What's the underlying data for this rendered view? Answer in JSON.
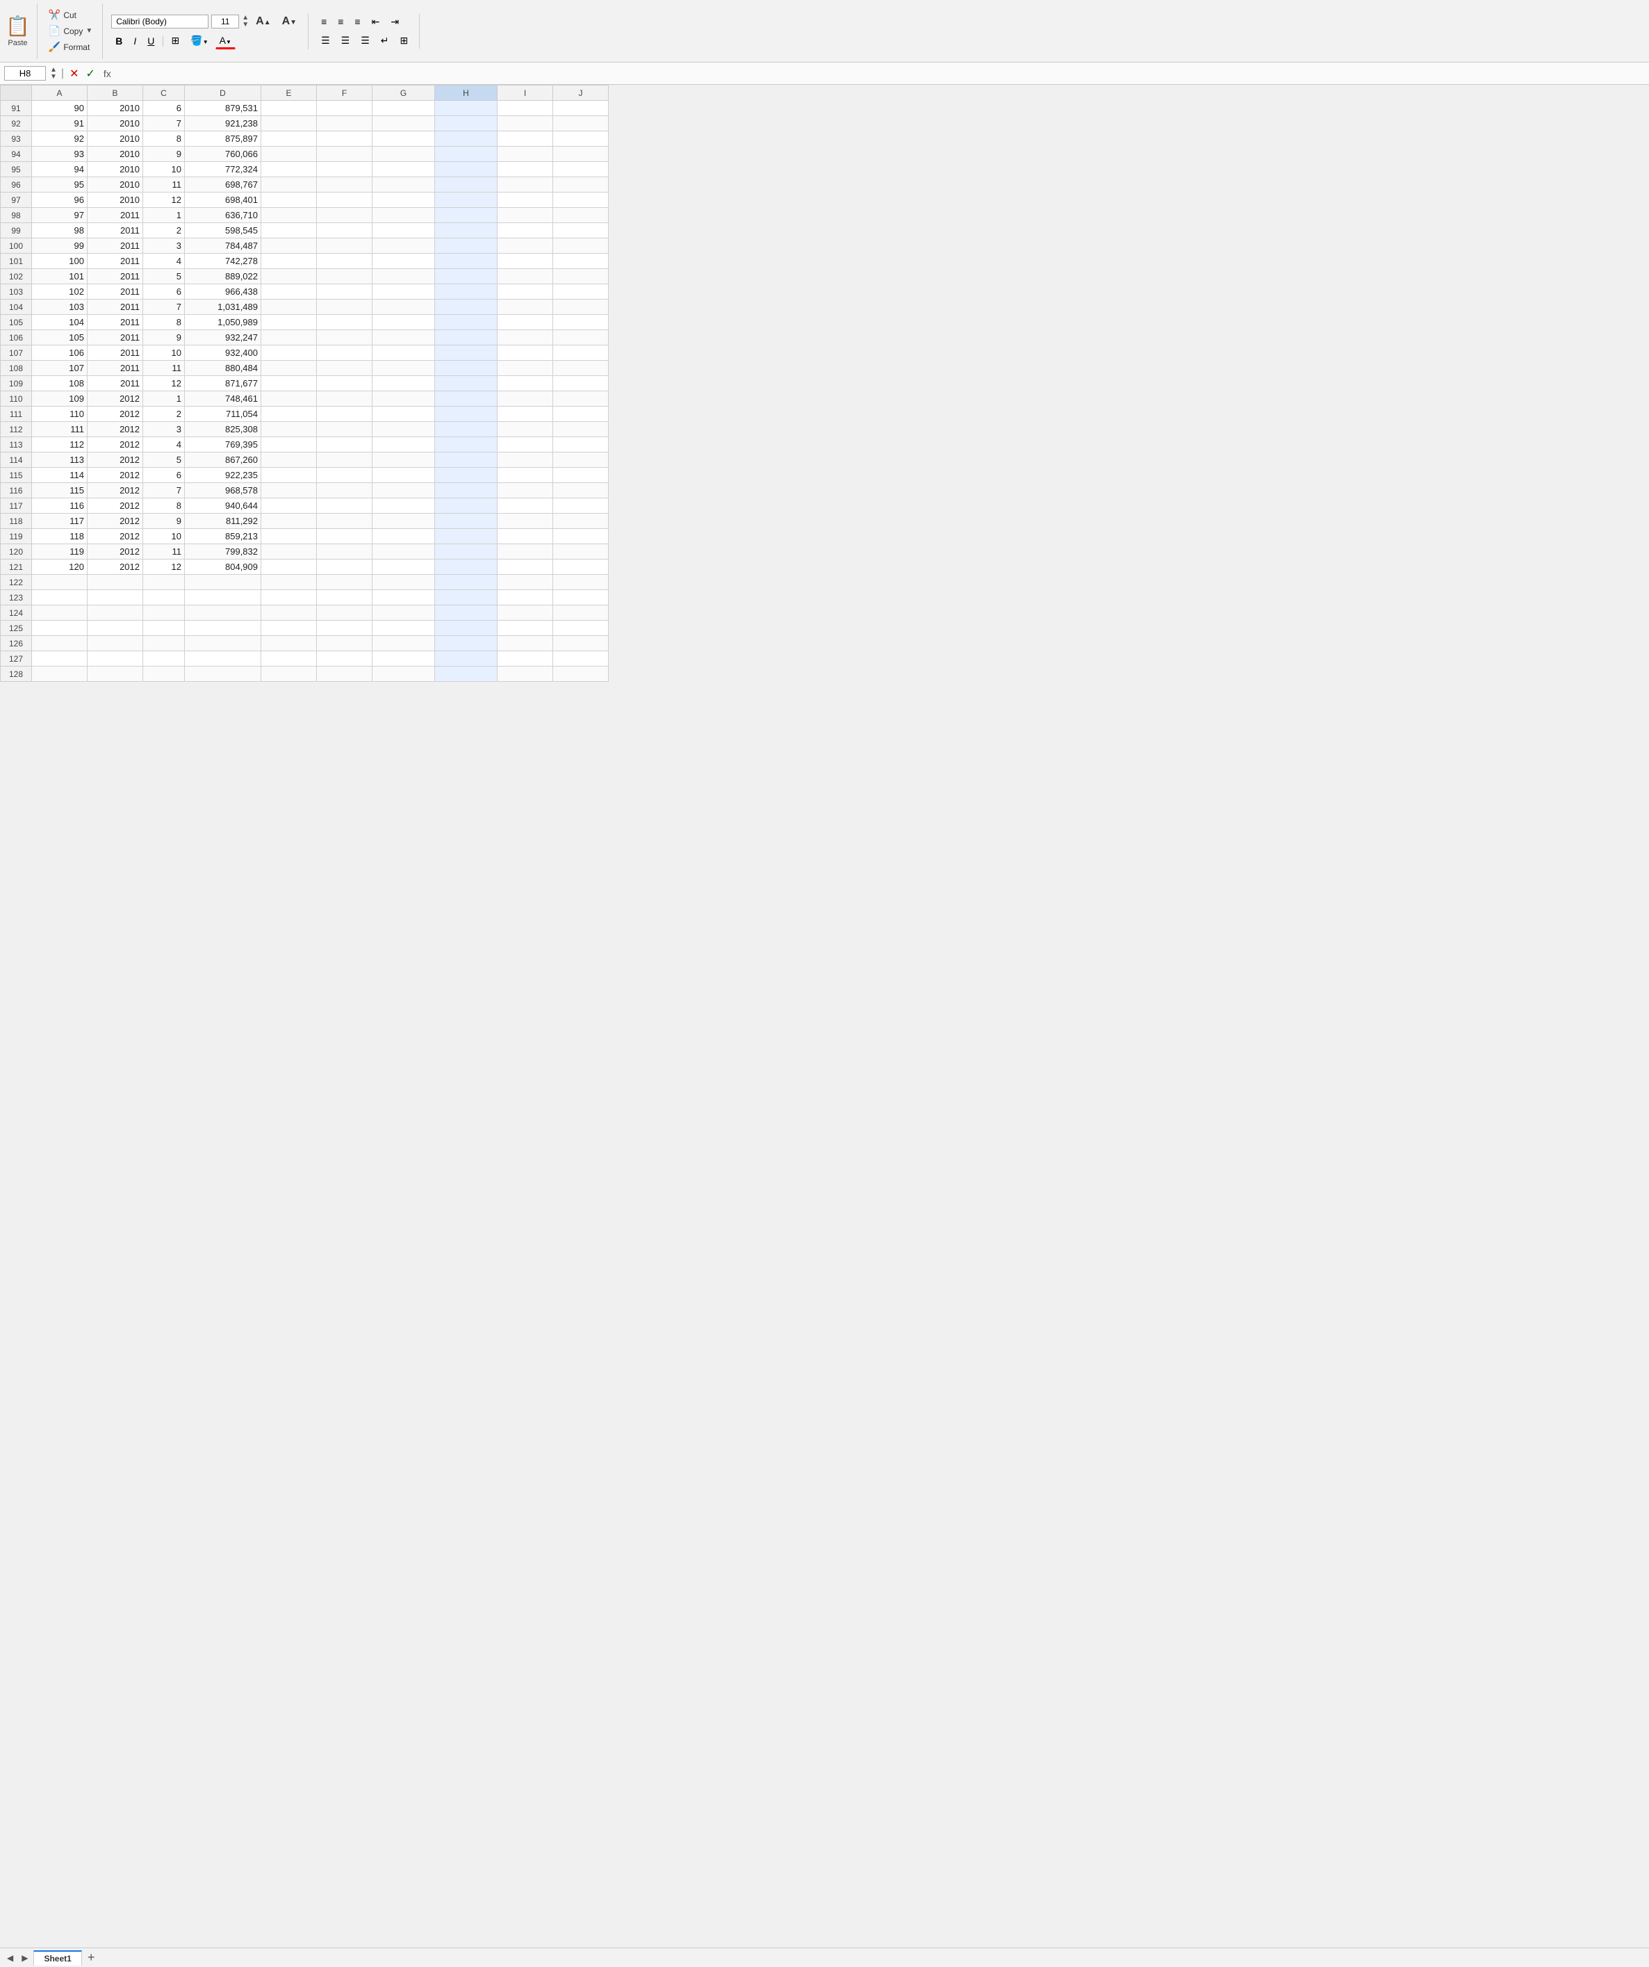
{
  "toolbar": {
    "paste_label": "Paste",
    "cut_label": "Cut",
    "copy_label": "Copy",
    "format_label": "Format",
    "font_name": "Calibri (Body)",
    "font_size": "11",
    "bold_label": "B",
    "italic_label": "I",
    "underline_label": "U",
    "increase_font_label": "A▲",
    "decrease_font_label": "A▼"
  },
  "formula_bar": {
    "cell_ref": "H8",
    "formula": "fx",
    "content": ""
  },
  "columns": [
    {
      "label": "",
      "key": "row_num"
    },
    {
      "label": "A",
      "key": "a"
    },
    {
      "label": "B",
      "key": "b"
    },
    {
      "label": "C",
      "key": "c"
    },
    {
      "label": "D",
      "key": "d"
    },
    {
      "label": "E",
      "key": "e"
    },
    {
      "label": "F",
      "key": "f"
    },
    {
      "label": "G",
      "key": "g"
    },
    {
      "label": "H",
      "key": "h"
    },
    {
      "label": "I",
      "key": "i"
    },
    {
      "label": "J",
      "key": "j"
    }
  ],
  "rows": [
    {
      "row_num": 91,
      "a": 90,
      "b": 2010,
      "c": 6,
      "d": "879,531"
    },
    {
      "row_num": 92,
      "a": 91,
      "b": 2010,
      "c": 7,
      "d": "921,238"
    },
    {
      "row_num": 93,
      "a": 92,
      "b": 2010,
      "c": 8,
      "d": "875,897"
    },
    {
      "row_num": 94,
      "a": 93,
      "b": 2010,
      "c": 9,
      "d": "760,066"
    },
    {
      "row_num": 95,
      "a": 94,
      "b": 2010,
      "c": 10,
      "d": "772,324"
    },
    {
      "row_num": 96,
      "a": 95,
      "b": 2010,
      "c": 11,
      "d": "698,767"
    },
    {
      "row_num": 97,
      "a": 96,
      "b": 2010,
      "c": 12,
      "d": "698,401"
    },
    {
      "row_num": 98,
      "a": 97,
      "b": 2011,
      "c": 1,
      "d": "636,710"
    },
    {
      "row_num": 99,
      "a": 98,
      "b": 2011,
      "c": 2,
      "d": "598,545"
    },
    {
      "row_num": 100,
      "a": 99,
      "b": 2011,
      "c": 3,
      "d": "784,487"
    },
    {
      "row_num": 101,
      "a": 100,
      "b": 2011,
      "c": 4,
      "d": "742,278"
    },
    {
      "row_num": 102,
      "a": 101,
      "b": 2011,
      "c": 5,
      "d": "889,022"
    },
    {
      "row_num": 103,
      "a": 102,
      "b": 2011,
      "c": 6,
      "d": "966,438"
    },
    {
      "row_num": 104,
      "a": 103,
      "b": 2011,
      "c": 7,
      "d": "1,031,489"
    },
    {
      "row_num": 105,
      "a": 104,
      "b": 2011,
      "c": 8,
      "d": "1,050,989"
    },
    {
      "row_num": 106,
      "a": 105,
      "b": 2011,
      "c": 9,
      "d": "932,247"
    },
    {
      "row_num": 107,
      "a": 106,
      "b": 2011,
      "c": 10,
      "d": "932,400"
    },
    {
      "row_num": 108,
      "a": 107,
      "b": 2011,
      "c": 11,
      "d": "880,484"
    },
    {
      "row_num": 109,
      "a": 108,
      "b": 2011,
      "c": 12,
      "d": "871,677"
    },
    {
      "row_num": 110,
      "a": 109,
      "b": 2012,
      "c": 1,
      "d": "748,461"
    },
    {
      "row_num": 111,
      "a": 110,
      "b": 2012,
      "c": 2,
      "d": "711,054"
    },
    {
      "row_num": 112,
      "a": 111,
      "b": 2012,
      "c": 3,
      "d": "825,308"
    },
    {
      "row_num": 113,
      "a": 112,
      "b": 2012,
      "c": 4,
      "d": "769,395"
    },
    {
      "row_num": 114,
      "a": 113,
      "b": 2012,
      "c": 5,
      "d": "867,260"
    },
    {
      "row_num": 115,
      "a": 114,
      "b": 2012,
      "c": 6,
      "d": "922,235"
    },
    {
      "row_num": 116,
      "a": 115,
      "b": 2012,
      "c": 7,
      "d": "968,578"
    },
    {
      "row_num": 117,
      "a": 116,
      "b": 2012,
      "c": 8,
      "d": "940,644"
    },
    {
      "row_num": 118,
      "a": 117,
      "b": 2012,
      "c": 9,
      "d": "811,292"
    },
    {
      "row_num": 119,
      "a": 118,
      "b": 2012,
      "c": 10,
      "d": "859,213"
    },
    {
      "row_num": 120,
      "a": 119,
      "b": 2012,
      "c": 11,
      "d": "799,832"
    },
    {
      "row_num": 121,
      "a": 120,
      "b": 2012,
      "c": 12,
      "d": "804,909"
    },
    {
      "row_num": 122,
      "a": "",
      "b": "",
      "c": "",
      "d": ""
    },
    {
      "row_num": 123,
      "a": "",
      "b": "",
      "c": "",
      "d": ""
    },
    {
      "row_num": 124,
      "a": "",
      "b": "",
      "c": "",
      "d": ""
    },
    {
      "row_num": 125,
      "a": "",
      "b": "",
      "c": "",
      "d": ""
    },
    {
      "row_num": 126,
      "a": "",
      "b": "",
      "c": "",
      "d": ""
    },
    {
      "row_num": 127,
      "a": "",
      "b": "",
      "c": "",
      "d": ""
    },
    {
      "row_num": 128,
      "a": "",
      "b": "",
      "c": "",
      "d": ""
    }
  ],
  "sheet_tabs": [
    {
      "label": "Sheet1",
      "active": true
    }
  ],
  "sheet_add_label": "+",
  "colors": {
    "accent": "#1a73e8",
    "selected_col_header": "#c5d9f1",
    "toolbar_bg": "#f2f2f2"
  }
}
